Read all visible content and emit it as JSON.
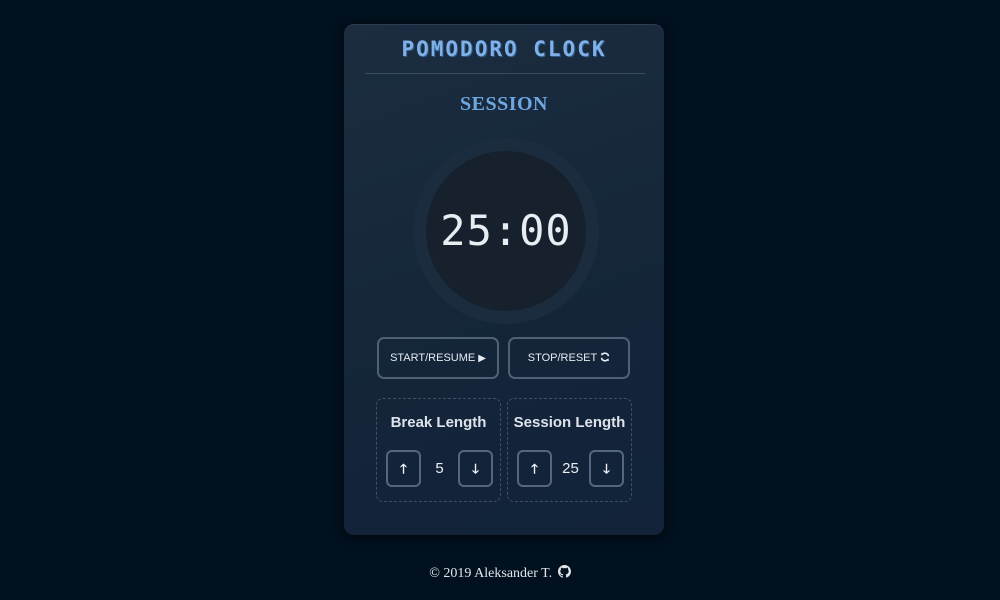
{
  "app": {
    "title": "POMODORO CLOCK",
    "mode": "SESSION",
    "time": "25:00"
  },
  "controls": {
    "start_label": "START/RESUME",
    "start_icon": "play-icon",
    "stop_label": "STOP/RESET",
    "stop_icon": "refresh-icon"
  },
  "break_panel": {
    "label": "Break Length",
    "value": "5",
    "up_icon": "arrow-up-icon",
    "down_icon": "arrow-down-icon"
  },
  "session_panel": {
    "label": "Session Length",
    "value": "25",
    "up_icon": "arrow-up-icon",
    "down_icon": "arrow-down-icon"
  },
  "footer": {
    "text": "© 2019 Aleksander T.",
    "icon": "github-icon"
  },
  "colors": {
    "background": "#02111f",
    "card": "#1a2b3e",
    "accent": "#6ea7e0",
    "title": "#7fb0e8",
    "text": "#e8edf2"
  }
}
